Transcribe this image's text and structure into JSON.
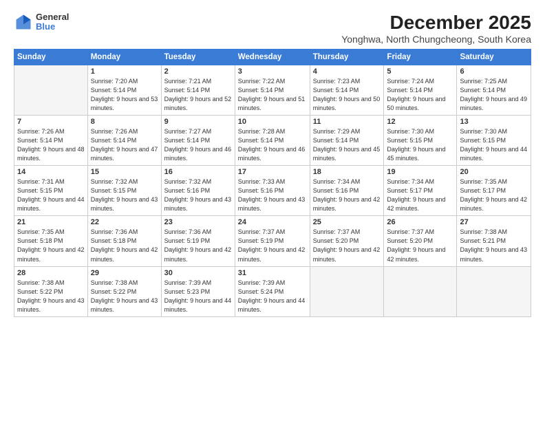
{
  "header": {
    "logo": {
      "general": "General",
      "blue": "Blue"
    },
    "title": "December 2025",
    "location": "Yonghwa, North Chungcheong, South Korea"
  },
  "calendar": {
    "weekdays": [
      "Sunday",
      "Monday",
      "Tuesday",
      "Wednesday",
      "Thursday",
      "Friday",
      "Saturday"
    ],
    "weeks": [
      [
        {
          "day": "",
          "empty": true
        },
        {
          "day": "1",
          "sunrise": "Sunrise: 7:20 AM",
          "sunset": "Sunset: 5:14 PM",
          "daylight": "Daylight: 9 hours and 53 minutes."
        },
        {
          "day": "2",
          "sunrise": "Sunrise: 7:21 AM",
          "sunset": "Sunset: 5:14 PM",
          "daylight": "Daylight: 9 hours and 52 minutes."
        },
        {
          "day": "3",
          "sunrise": "Sunrise: 7:22 AM",
          "sunset": "Sunset: 5:14 PM",
          "daylight": "Daylight: 9 hours and 51 minutes."
        },
        {
          "day": "4",
          "sunrise": "Sunrise: 7:23 AM",
          "sunset": "Sunset: 5:14 PM",
          "daylight": "Daylight: 9 hours and 50 minutes."
        },
        {
          "day": "5",
          "sunrise": "Sunrise: 7:24 AM",
          "sunset": "Sunset: 5:14 PM",
          "daylight": "Daylight: 9 hours and 50 minutes."
        },
        {
          "day": "6",
          "sunrise": "Sunrise: 7:25 AM",
          "sunset": "Sunset: 5:14 PM",
          "daylight": "Daylight: 9 hours and 49 minutes."
        }
      ],
      [
        {
          "day": "7",
          "sunrise": "Sunrise: 7:26 AM",
          "sunset": "Sunset: 5:14 PM",
          "daylight": "Daylight: 9 hours and 48 minutes."
        },
        {
          "day": "8",
          "sunrise": "Sunrise: 7:26 AM",
          "sunset": "Sunset: 5:14 PM",
          "daylight": "Daylight: 9 hours and 47 minutes."
        },
        {
          "day": "9",
          "sunrise": "Sunrise: 7:27 AM",
          "sunset": "Sunset: 5:14 PM",
          "daylight": "Daylight: 9 hours and 46 minutes."
        },
        {
          "day": "10",
          "sunrise": "Sunrise: 7:28 AM",
          "sunset": "Sunset: 5:14 PM",
          "daylight": "Daylight: 9 hours and 46 minutes."
        },
        {
          "day": "11",
          "sunrise": "Sunrise: 7:29 AM",
          "sunset": "Sunset: 5:14 PM",
          "daylight": "Daylight: 9 hours and 45 minutes."
        },
        {
          "day": "12",
          "sunrise": "Sunrise: 7:30 AM",
          "sunset": "Sunset: 5:15 PM",
          "daylight": "Daylight: 9 hours and 45 minutes."
        },
        {
          "day": "13",
          "sunrise": "Sunrise: 7:30 AM",
          "sunset": "Sunset: 5:15 PM",
          "daylight": "Daylight: 9 hours and 44 minutes."
        }
      ],
      [
        {
          "day": "14",
          "sunrise": "Sunrise: 7:31 AM",
          "sunset": "Sunset: 5:15 PM",
          "daylight": "Daylight: 9 hours and 44 minutes."
        },
        {
          "day": "15",
          "sunrise": "Sunrise: 7:32 AM",
          "sunset": "Sunset: 5:15 PM",
          "daylight": "Daylight: 9 hours and 43 minutes."
        },
        {
          "day": "16",
          "sunrise": "Sunrise: 7:32 AM",
          "sunset": "Sunset: 5:16 PM",
          "daylight": "Daylight: 9 hours and 43 minutes."
        },
        {
          "day": "17",
          "sunrise": "Sunrise: 7:33 AM",
          "sunset": "Sunset: 5:16 PM",
          "daylight": "Daylight: 9 hours and 43 minutes."
        },
        {
          "day": "18",
          "sunrise": "Sunrise: 7:34 AM",
          "sunset": "Sunset: 5:16 PM",
          "daylight": "Daylight: 9 hours and 42 minutes."
        },
        {
          "day": "19",
          "sunrise": "Sunrise: 7:34 AM",
          "sunset": "Sunset: 5:17 PM",
          "daylight": "Daylight: 9 hours and 42 minutes."
        },
        {
          "day": "20",
          "sunrise": "Sunrise: 7:35 AM",
          "sunset": "Sunset: 5:17 PM",
          "daylight": "Daylight: 9 hours and 42 minutes."
        }
      ],
      [
        {
          "day": "21",
          "sunrise": "Sunrise: 7:35 AM",
          "sunset": "Sunset: 5:18 PM",
          "daylight": "Daylight: 9 hours and 42 minutes."
        },
        {
          "day": "22",
          "sunrise": "Sunrise: 7:36 AM",
          "sunset": "Sunset: 5:18 PM",
          "daylight": "Daylight: 9 hours and 42 minutes."
        },
        {
          "day": "23",
          "sunrise": "Sunrise: 7:36 AM",
          "sunset": "Sunset: 5:19 PM",
          "daylight": "Daylight: 9 hours and 42 minutes."
        },
        {
          "day": "24",
          "sunrise": "Sunrise: 7:37 AM",
          "sunset": "Sunset: 5:19 PM",
          "daylight": "Daylight: 9 hours and 42 minutes."
        },
        {
          "day": "25",
          "sunrise": "Sunrise: 7:37 AM",
          "sunset": "Sunset: 5:20 PM",
          "daylight": "Daylight: 9 hours and 42 minutes."
        },
        {
          "day": "26",
          "sunrise": "Sunrise: 7:37 AM",
          "sunset": "Sunset: 5:20 PM",
          "daylight": "Daylight: 9 hours and 42 minutes."
        },
        {
          "day": "27",
          "sunrise": "Sunrise: 7:38 AM",
          "sunset": "Sunset: 5:21 PM",
          "daylight": "Daylight: 9 hours and 43 minutes."
        }
      ],
      [
        {
          "day": "28",
          "sunrise": "Sunrise: 7:38 AM",
          "sunset": "Sunset: 5:22 PM",
          "daylight": "Daylight: 9 hours and 43 minutes."
        },
        {
          "day": "29",
          "sunrise": "Sunrise: 7:38 AM",
          "sunset": "Sunset: 5:22 PM",
          "daylight": "Daylight: 9 hours and 43 minutes."
        },
        {
          "day": "30",
          "sunrise": "Sunrise: 7:39 AM",
          "sunset": "Sunset: 5:23 PM",
          "daylight": "Daylight: 9 hours and 44 minutes."
        },
        {
          "day": "31",
          "sunrise": "Sunrise: 7:39 AM",
          "sunset": "Sunset: 5:24 PM",
          "daylight": "Daylight: 9 hours and 44 minutes."
        },
        {
          "day": "",
          "empty": true
        },
        {
          "day": "",
          "empty": true
        },
        {
          "day": "",
          "empty": true
        }
      ]
    ]
  }
}
